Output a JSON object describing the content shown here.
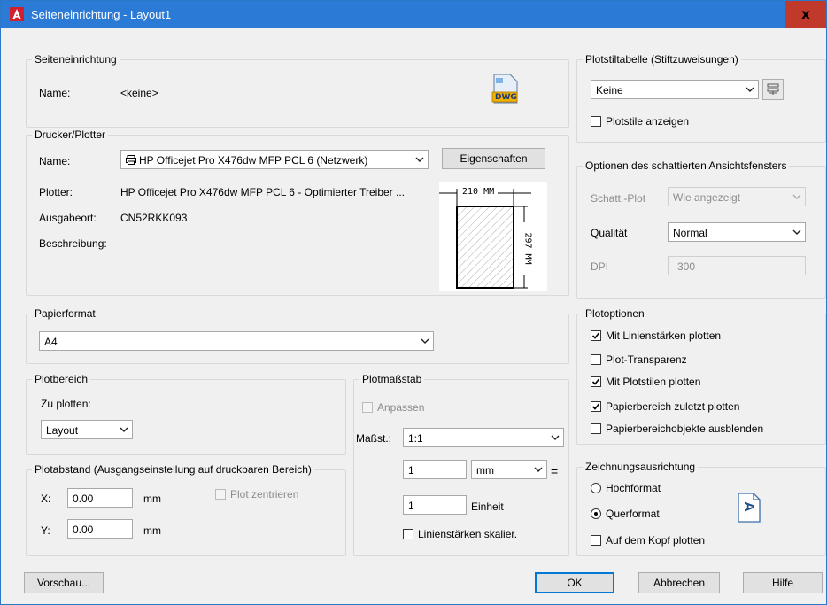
{
  "window": {
    "title": "Seiteneinrichtung - Layout1",
    "close": "x"
  },
  "page_setup": {
    "legend": "Seiteneinrichtung",
    "name_label": "Name:",
    "name_value": "<keine>",
    "file_badge": "DWG"
  },
  "printer": {
    "legend": "Drucker/Plotter",
    "name_label": "Name:",
    "name_value": "HP Officejet Pro X476dw MFP PCL 6 (Netzwerk)",
    "properties_button": "Eigenschaften",
    "plotter_label": "Plotter:",
    "plotter_value": "HP Officejet Pro X476dw MFP PCL 6 - Optimierter Treiber ...",
    "location_label": "Ausgabeort:",
    "location_value": "CN52RKK093",
    "description_label": "Beschreibung:",
    "paper_width": "210 MM",
    "paper_height": "297 MM"
  },
  "paper": {
    "legend": "Papierformat",
    "value": "A4"
  },
  "plot_area": {
    "legend": "Plotbereich",
    "what_label": "Zu plotten:",
    "what_value": "Layout"
  },
  "plot_offset": {
    "legend": "Plotabstand (Ausgangseinstellung auf druckbaren Bereich)",
    "x_label": "X:",
    "x_value": "0.00",
    "x_unit": "mm",
    "y_label": "Y:",
    "y_value": "0.00",
    "y_unit": "mm",
    "center_label": "Plot zentrieren"
  },
  "plot_scale": {
    "legend": "Plotmaßstab",
    "fit_label": "Anpassen",
    "scale_label": "Maßst.:",
    "scale_value": "1:1",
    "value1": "1",
    "unit_value": "mm",
    "equals": "=",
    "value2": "1",
    "unit2_label": "Einheit",
    "scale_lineweights": "Linienstärken skalier."
  },
  "plot_style_table": {
    "legend": "Plotstiltabelle (Stiftzuweisungen)",
    "value": "Keine",
    "show_label": "Plotstile anzeigen"
  },
  "shaded_viewport": {
    "legend": "Optionen des schattierten Ansichtsfensters",
    "shade_label": "Schatt.-Plot",
    "shade_value": "Wie angezeigt",
    "quality_label": "Qualität",
    "quality_value": "Normal",
    "dpi_label": "DPI",
    "dpi_value": "300"
  },
  "plot_options": {
    "legend": "Plotoptionen",
    "items": [
      {
        "label": "Mit Linienstärken plotten",
        "checked": true
      },
      {
        "label": "Plot-Transparenz",
        "checked": false
      },
      {
        "label": "Mit Plotstilen plotten",
        "checked": true
      },
      {
        "label": "Papierbereich zuletzt plotten",
        "checked": true
      },
      {
        "label": "Papierbereichobjekte ausblenden",
        "checked": false
      }
    ]
  },
  "orientation": {
    "legend": "Zeichnungsausrichtung",
    "portrait": "Hochformat",
    "landscape": "Querformat",
    "upside_down": "Auf dem Kopf plotten",
    "orientation_glyph": "A"
  },
  "footer": {
    "preview": "Vorschau...",
    "ok": "OK",
    "cancel": "Abbrechen",
    "help": "Hilfe"
  },
  "colors": {
    "titlebar": "#2b7ad6",
    "close": "#c0392b",
    "autocad_red": "#d01f2e"
  }
}
